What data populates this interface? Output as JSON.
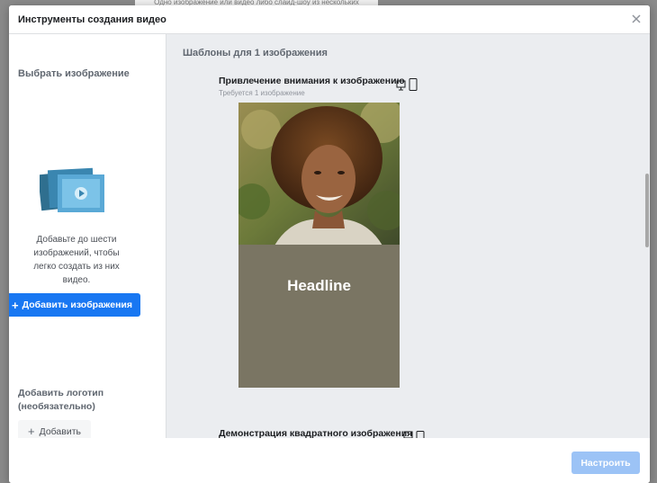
{
  "background": {
    "strip_text": "Одно изображение или видео либо слайд-шоу из нескольких"
  },
  "dialog": {
    "title": "Инструменты создания видео",
    "close_icon": "close-icon"
  },
  "sidebar": {
    "select_title": "Выбрать изображение",
    "description": "Добавьте до шести изображений, чтобы легко создать из них видео.",
    "add_images_label": "Добавить изображения",
    "logo_title_line1": "Добавить логотип",
    "logo_title_line2": "(необязательно)",
    "add_logo_label": "Добавить"
  },
  "main": {
    "section_title": "Шаблоны для 1 изображения",
    "templates": [
      {
        "title": "Привлечение внимания к изображению",
        "subtitle": "Требуется 1 изображение",
        "headline": "Headline",
        "panel_color": "#7a7563"
      },
      {
        "title": "Демонстрация квадратного изображения"
      }
    ]
  },
  "footer": {
    "configure_label": "Настроить"
  },
  "colors": {
    "accent": "#1877f2",
    "disabled_accent": "#9cc3f6"
  }
}
